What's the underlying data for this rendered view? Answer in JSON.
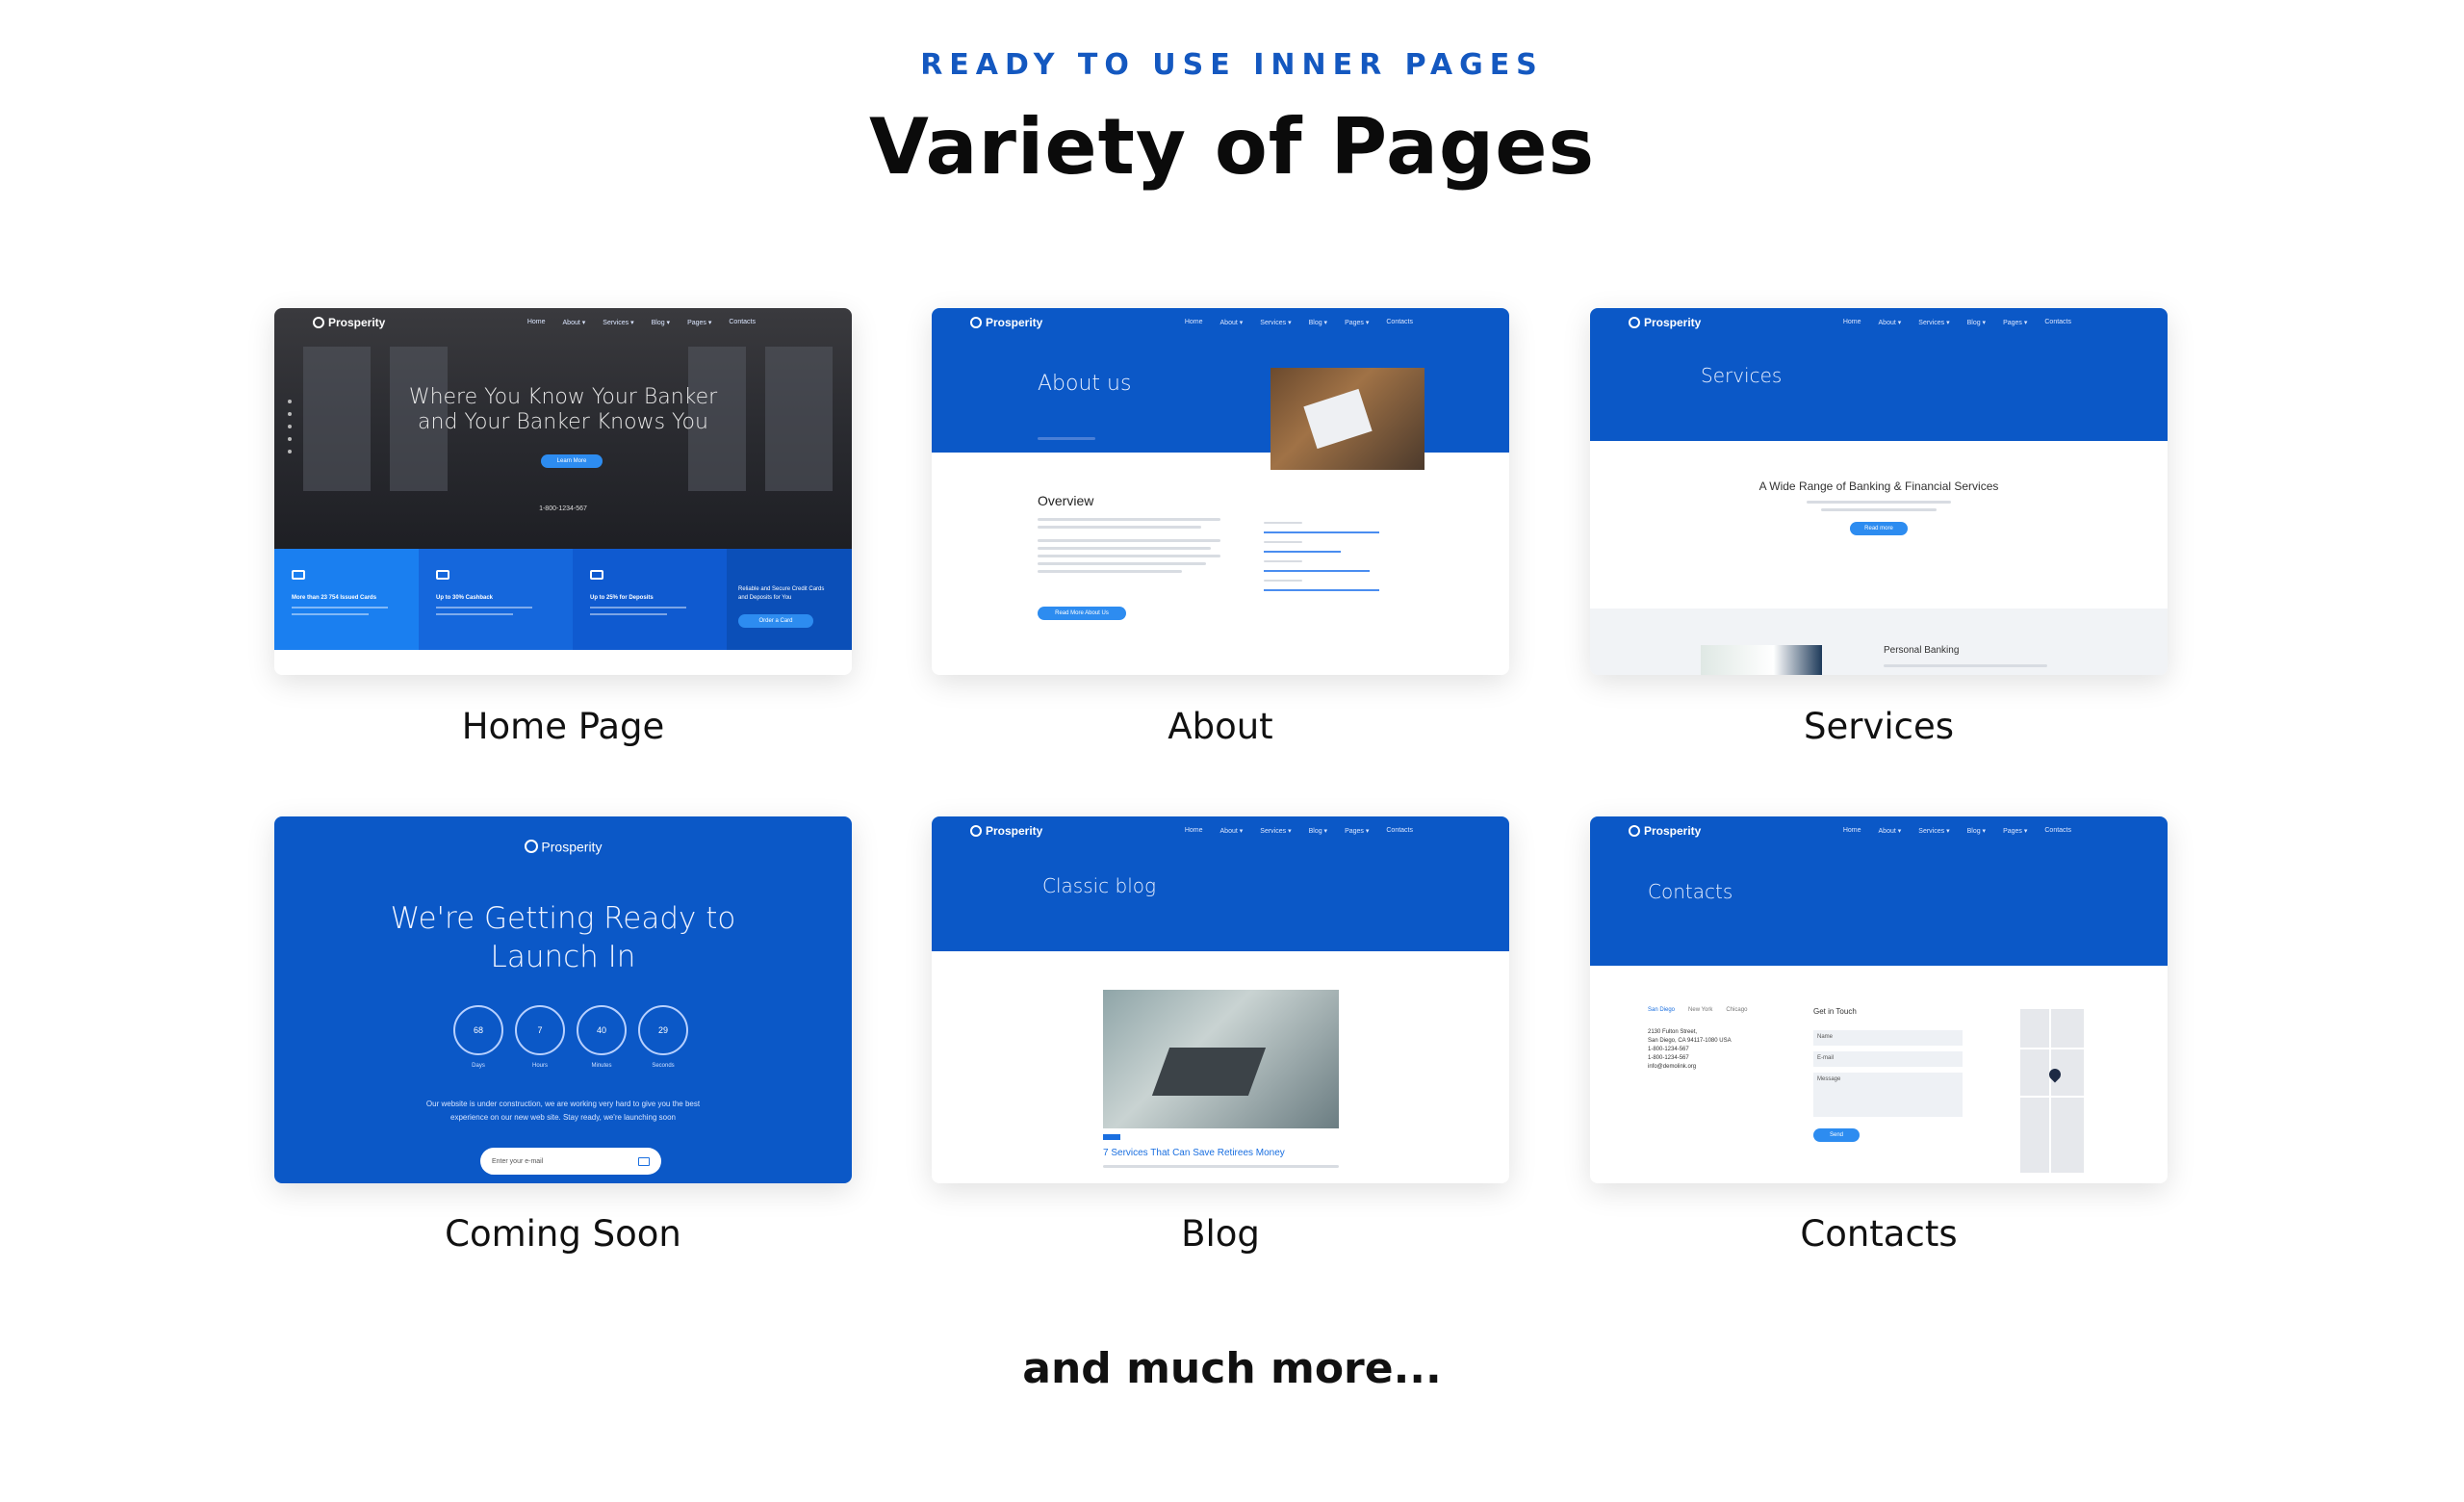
{
  "header": {
    "eyebrow": "READY TO USE INNER PAGES",
    "title": "Variety of Pages"
  },
  "footer_text": "and much more...",
  "colors": {
    "brand_blue": "#0b58c7",
    "accent": "#1458c0"
  },
  "nav": {
    "logo": "Prosperity",
    "items": [
      "Home",
      "About ▾",
      "Services ▾",
      "Blog ▾",
      "Pages ▾",
      "Contacts"
    ]
  },
  "cards": [
    {
      "caption": "Home Page"
    },
    {
      "caption": "About"
    },
    {
      "caption": "Services"
    },
    {
      "caption": "Coming Soon"
    },
    {
      "caption": "Blog"
    },
    {
      "caption": "Contacts"
    }
  ],
  "home": {
    "hero_line1": "Where You Know Your Banker",
    "hero_line2": "and Your Banker Knows You",
    "cta": "Learn More",
    "phone": "1-800-1234-567",
    "strip": [
      {
        "text": "More than 23 754 Issued Cards"
      },
      {
        "text": "Up to 30% Cashback"
      },
      {
        "text": "Up to 25% for Deposits"
      },
      {
        "text": "Reliable and Secure Credit Cards and Deposits for You",
        "button": "Order a Card"
      }
    ]
  },
  "about": {
    "title": "About us",
    "section": "Overview",
    "button": "Read More About Us"
  },
  "services": {
    "title": "Services",
    "heading": "A Wide Range of Banking & Financial Services",
    "button": "Read more",
    "subsection": "Personal Banking"
  },
  "coming": {
    "logo": "Prosperity",
    "title_line1": "We're Getting Ready to",
    "title_line2": "Launch In",
    "countdown": [
      {
        "value": "68",
        "label": "Days"
      },
      {
        "value": "7",
        "label": "Hours"
      },
      {
        "value": "40",
        "label": "Minutes"
      },
      {
        "value": "29",
        "label": "Seconds"
      }
    ],
    "text_line1": "Our website is under construction, we are working very hard to give you the best",
    "text_line2": "experience on our new web site. Stay ready, we're launching soon",
    "email_placeholder": "Enter your e-mail"
  },
  "blog": {
    "title": "Classic blog",
    "post_title": "7 Services That Can Save Retirees Money"
  },
  "contacts": {
    "title": "Contacts",
    "tabs": [
      "San Diego",
      "New York",
      "Chicago"
    ],
    "address_line1": "2130 Fulton Street,",
    "address_line2": "San Diego, CA 94117-1080 USA",
    "phone1": "1-800-1234-567",
    "phone2": "1-800-1234-567",
    "email": "info@demolink.org",
    "form_title": "Get in Touch",
    "name_field": "Name",
    "email_field": "E-mail",
    "message_field": "Message",
    "send": "Send"
  }
}
